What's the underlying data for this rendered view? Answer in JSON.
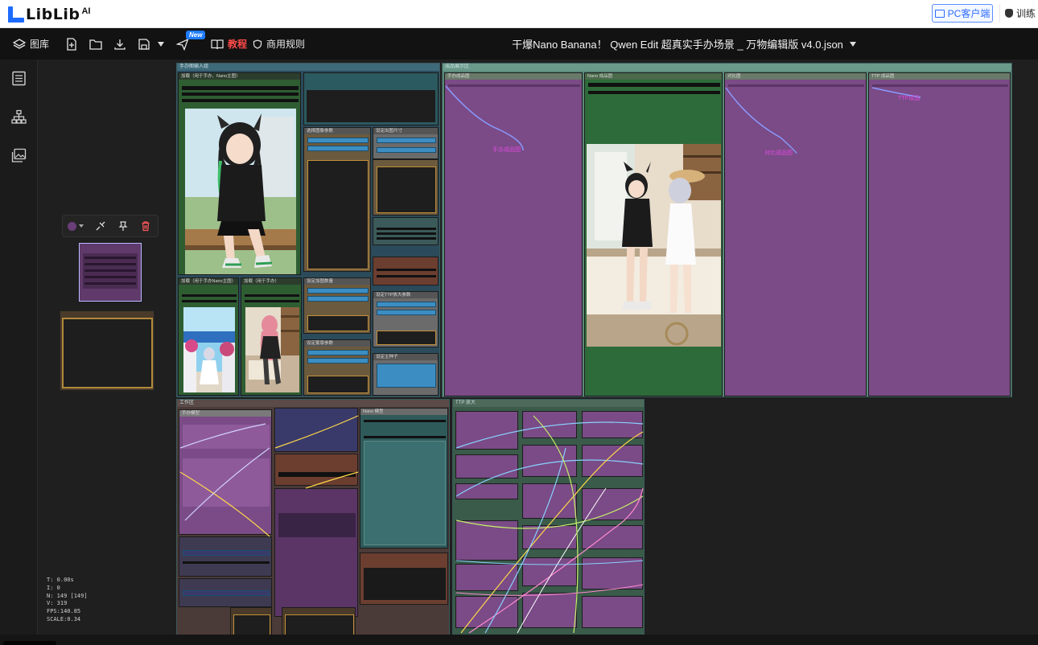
{
  "topbar": {
    "logo_text": "LibLib",
    "logo_suffix": "AI",
    "pc_client": "PC客户端",
    "train": "训练"
  },
  "toolbar": {
    "gallery": "图库",
    "new_badge": "New",
    "tutorial": "教程",
    "commercial_rules": "商用规则",
    "workflow_title": "干爆Nano Banana！ Qwen Edit 超真实手办场景 _ 万物编辑版 v4.0.json"
  },
  "canvas": {
    "groups": {
      "input": "手办图输入组",
      "output": "成品展示区",
      "workspace": "工作区",
      "upscale": "TTP 放大"
    },
    "nodes": {
      "main_load": "加载（用于手办、Nano主图）",
      "ref_a": "加载（用于手办Nano主图）",
      "ref_b": "加载（用于手办）",
      "cfg1": "选择图像参数",
      "cfg2": "设定出图尺寸",
      "cfg3": "设定加图数量",
      "cfg4": "设定TTP放大参数",
      "cfg5": "设定蒙版参数",
      "cfg6": "设定主种子",
      "out1": "手办成品图",
      "out2": "Nano 成品图",
      "out3": "对比图",
      "out4": "TTP 成品图",
      "work1": "手办模型",
      "work2": "Nano 模型"
    },
    "link_labels": {
      "l1": "手办成品图",
      "l2": "对比成品图",
      "l3": "TTP成品"
    }
  },
  "stats": {
    "t": "T: 0.00s",
    "i": "I: 0",
    "n": "N: 149 [149]",
    "v": "V: 319",
    "fps": "FPS:140.85",
    "scale": "SCALE:0.34"
  },
  "colors": {
    "accent_blue": "#1e6bff",
    "tutorial_red": "#ff4a4a",
    "node_purple": "#7a4b86",
    "node_green": "#2e5d32",
    "node_teal": "#2f5a5a"
  }
}
